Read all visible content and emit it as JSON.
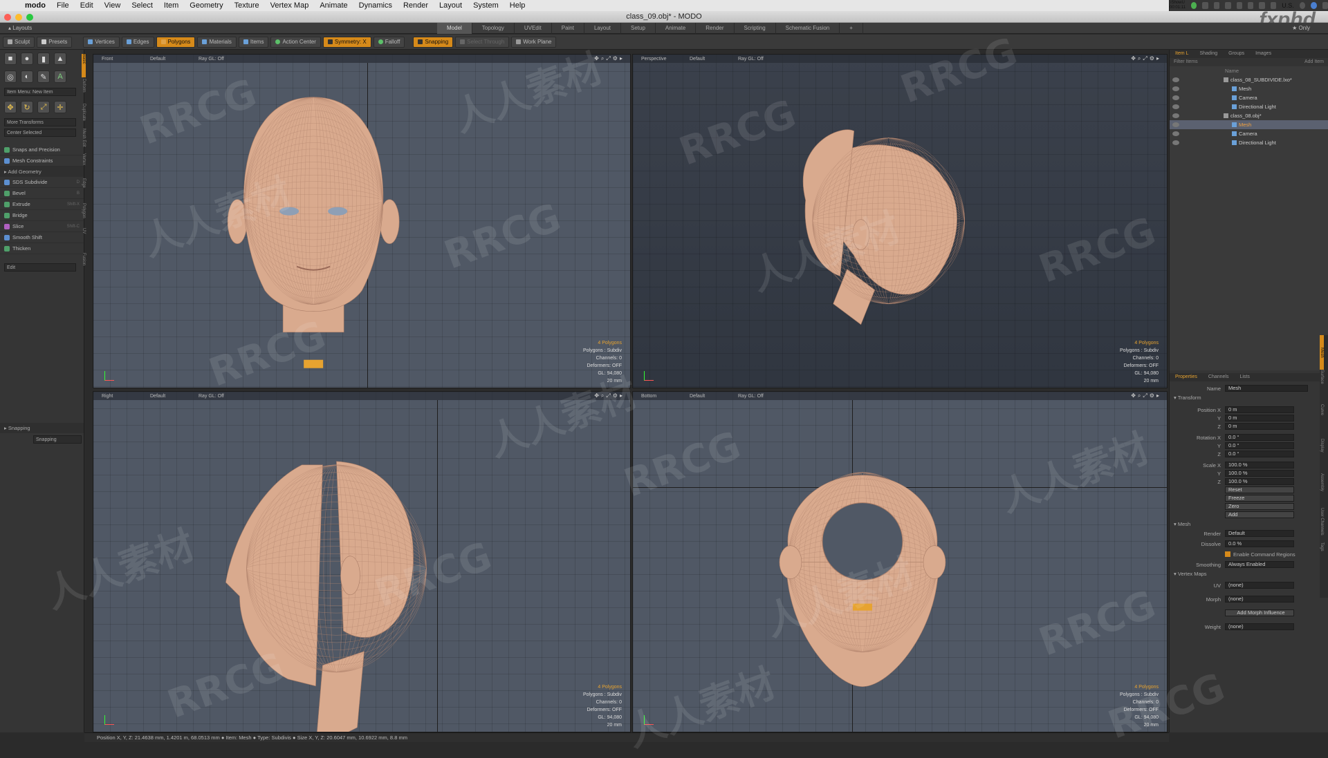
{
  "mac": {
    "app": "modo",
    "menus": [
      "File",
      "Edit",
      "View",
      "Select",
      "Item",
      "Geometry",
      "Texture",
      "Vertex Map",
      "Animate",
      "Dynamics",
      "Render",
      "Layout",
      "System",
      "Help"
    ],
    "clock_top": "iShowU",
    "clock_bottom": "00:01:11",
    "locale": "U.S."
  },
  "window": {
    "title": "class_09.obj* - MODO"
  },
  "layout_tabs": {
    "label": "Layouts",
    "tabs": [
      "Model",
      "Topology",
      "UVEdit",
      "Paint",
      "Layout",
      "Setup",
      "Animate",
      "Render",
      "Scripting",
      "Schematic Fusion"
    ],
    "active": "Model",
    "add": "+",
    "only": "Only"
  },
  "toolbar": {
    "sculpt": "Sculpt",
    "presets": "Presets",
    "vertices": "Vertices",
    "edges": "Edges",
    "polygons": "Polygons",
    "materials": "Materials",
    "items": "Items",
    "action_center": "Action Center",
    "symmetry": "Symmetry: X",
    "falloff": "Falloff",
    "snapping": "Snapping",
    "select_through": "Select Through",
    "work_plane": "Work Plane"
  },
  "left_panel": {
    "item_menu": "Item Menu: New Item",
    "more_transforms": "More Transforms",
    "center_selected": "Center Selected",
    "snaps": "Snaps and Precision",
    "mesh_constraints": "Mesh Constraints",
    "add_geometry": "Add Geometry",
    "tools": [
      {
        "label": "SDS Subdivide",
        "hotkey": "D"
      },
      {
        "label": "Bevel",
        "hotkey": "B"
      },
      {
        "label": "Extrude",
        "hotkey": "Shift-X"
      },
      {
        "label": "Bridge",
        "hotkey": ""
      },
      {
        "label": "Slice",
        "hotkey": "Shift-C"
      },
      {
        "label": "Smooth Shift",
        "hotkey": ""
      },
      {
        "label": "Thicken",
        "hotkey": ""
      }
    ],
    "edit": "Edit",
    "snapping_section": "Snapping",
    "snapping_btn": "Snapping",
    "vtabs": [
      "Basic",
      "Deform",
      "Duplicate",
      "Mesh Edit",
      "Vertex",
      "Edge",
      "Polygon",
      "UV",
      "Fusion"
    ]
  },
  "viewports": [
    {
      "view": "Front",
      "shading": "Default",
      "raygl": "Ray GL: Off",
      "stats": [
        "4 Polygons",
        "Polygons : Subdiv",
        "Channels: 0",
        "Deformers: OFF",
        "GL: 94,080",
        "20 mm"
      ]
    },
    {
      "view": "Perspective",
      "shading": "Default",
      "raygl": "Ray GL: Off",
      "stats": [
        "4 Polygons",
        "Polygons : Subdiv",
        "Channels: 0",
        "Deformers: OFF",
        "GL: 94,080",
        "20 mm"
      ]
    },
    {
      "view": "Right",
      "shading": "Default",
      "raygl": "Ray GL: Off",
      "stats": [
        "4 Polygons",
        "Polygons : Subdiv",
        "Channels: 0",
        "Deformers: OFF",
        "GL: 94,080",
        "20 mm"
      ]
    },
    {
      "view": "Bottom",
      "shading": "Default",
      "raygl": "Ray GL: Off",
      "stats": [
        "4 Polygons",
        "Polygons : Subdiv",
        "Channels: 0",
        "Deformers: OFF",
        "GL: 94,080",
        "20 mm"
      ]
    }
  ],
  "item_list": {
    "tabs": [
      "Item L",
      "Shading",
      "Groups",
      "Images"
    ],
    "filter": "Filter Items",
    "add_item": "Add Item",
    "col_name": "Name",
    "rows": [
      {
        "label": "class_08_SUBDIVIDE.lxo*",
        "indent": 0,
        "selected": false
      },
      {
        "label": "Mesh",
        "indent": 1,
        "selected": false
      },
      {
        "label": "Camera",
        "indent": 1,
        "selected": false
      },
      {
        "label": "Directional Light",
        "indent": 1,
        "selected": false
      },
      {
        "label": "class_08.obj*",
        "indent": 0,
        "selected": false
      },
      {
        "label": "Mesh",
        "indent": 1,
        "selected": true
      },
      {
        "label": "Camera",
        "indent": 1,
        "selected": false
      },
      {
        "label": "Directional Light",
        "indent": 1,
        "selected": false
      }
    ]
  },
  "properties": {
    "tabs": [
      "Properties",
      "Channels",
      "Lists"
    ],
    "name_label": "Name",
    "name_value": "Mesh",
    "transform": "Transform",
    "rows": [
      {
        "label": "Position X",
        "value": "0 m"
      },
      {
        "label": "Y",
        "value": "0 m"
      },
      {
        "label": "Z",
        "value": "0 m"
      },
      {
        "label": "Rotation X",
        "value": "0.0 °"
      },
      {
        "label": "Y",
        "value": "0.0 °"
      },
      {
        "label": "Z",
        "value": "0.0 °"
      },
      {
        "label": "Scale X",
        "value": "100.0 %"
      },
      {
        "label": "Y",
        "value": "100.0 %"
      },
      {
        "label": "Z",
        "value": "100.0 %"
      }
    ],
    "buttons": [
      "Reset",
      "Freeze",
      "Zero",
      "Add"
    ],
    "mesh": "Mesh",
    "render_label": "Render",
    "render_value": "Default",
    "dissolve_label": "Dissolve",
    "dissolve_value": "0.0 %",
    "enable_cmd": "Enable Command Regions",
    "smoothing_label": "Smoothing",
    "smoothing_value": "Always Enabled",
    "vertex_maps": "Vertex Maps",
    "uv_label": "UV",
    "uv_value": "(none)",
    "morph_label": "Morph",
    "morph_value": "(none)",
    "add_morph": "Add Morph Influence",
    "weight_label": "Weight",
    "weight_value": "(none)",
    "strip": [
      "Mesh",
      "Surface",
      "Curve",
      "Display",
      "Assembly",
      "User Channels",
      "Tags"
    ]
  },
  "status": "Position X, Y, Z:  21.4638 mm, 1.4201 m, 68.0513 mm ● Item:  Mesh ● Type:  Subdivis ● Size X, Y, Z:  20.6047 mm, 10.6922 mm, 8.8 mm",
  "watermark": {
    "site": "fxphd",
    "rrcg": "RRCG",
    "cn": "人人素材"
  }
}
